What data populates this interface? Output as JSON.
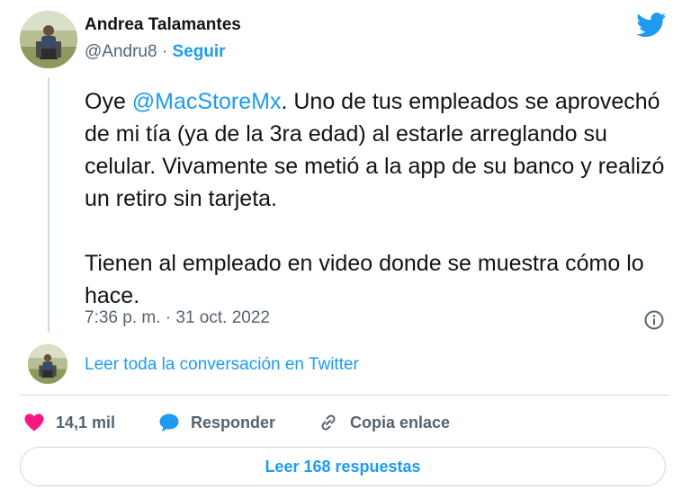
{
  "author": {
    "name": "Andrea Talamantes",
    "handle": "@Andru8",
    "separator": " · ",
    "follow_label": "Seguir"
  },
  "tweet": {
    "mention": "@MacStoreMx",
    "text_before_mention": "Oye ",
    "text_after_mention": ". Uno de tus empleados se aprovechó de mi tía (ya de la 3ra edad) al estarle arreglando su celular. Vivamente se metió a la app de su banco y realizó un retiro sin tarjeta.",
    "paragraph_2": "Tienen al empleado en video donde se muestra cómo lo hace.",
    "timestamp": "7:36 p. m. · 31 oct. 2022"
  },
  "thread": {
    "read_conversation_label": "Leer toda la conversación en Twitter"
  },
  "actions": {
    "like_count": "14,1 mil",
    "reply_label": "Responder",
    "copy_label": "Copia enlace"
  },
  "replies_button_label": "Leer 168 respuestas",
  "icons": {
    "logo": "twitter-bird-icon",
    "info": "info-icon",
    "like": "heart-icon",
    "reply": "speech-bubble-icon",
    "copy": "link-icon"
  },
  "colors": {
    "accent": "#1d9bf0",
    "like": "#f91880",
    "muted": "#536471",
    "text": "#0f1419",
    "border": "#cfd9de"
  }
}
